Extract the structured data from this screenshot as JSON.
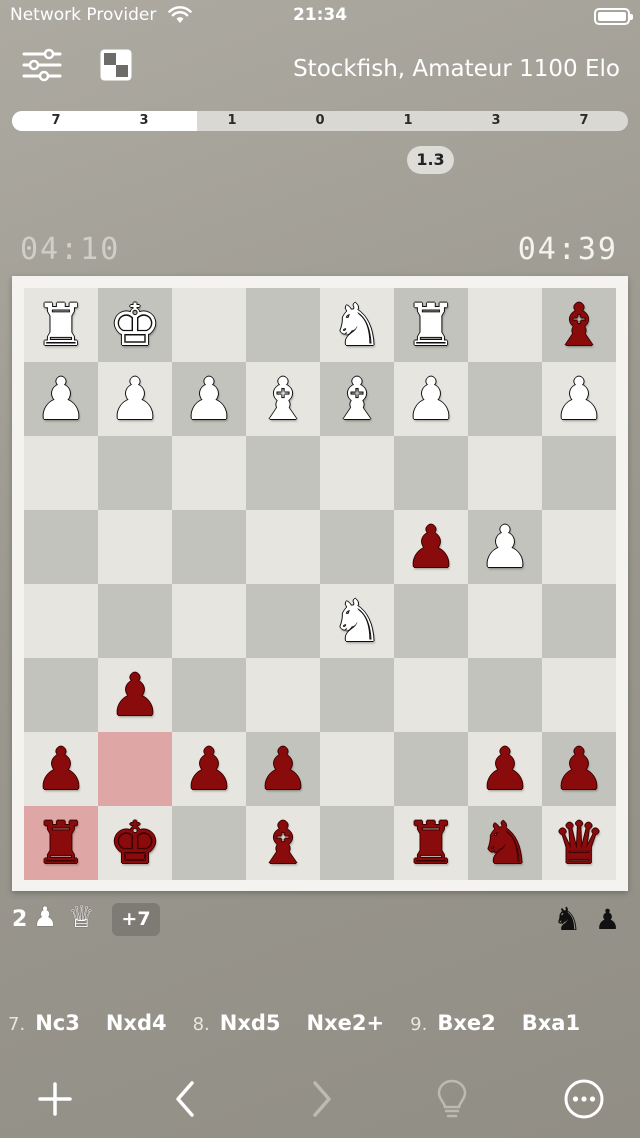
{
  "status_bar": {
    "carrier": "Network Provider",
    "time": "21:34"
  },
  "header": {
    "opponent": "Stockfish, Amateur 1100 Elo"
  },
  "eval_bar": {
    "ticks": [
      "7",
      "3",
      "1",
      "0",
      "1",
      "3",
      "7"
    ],
    "white_fraction": 0.3,
    "score": "1.3"
  },
  "clocks": {
    "left": "04:10",
    "right": "04:39"
  },
  "board": {
    "rows": [
      [
        "wR",
        "wK",
        "",
        "",
        "wN",
        "wR",
        "",
        "rB"
      ],
      [
        "wP",
        "wP",
        "wP",
        "wB",
        "wB",
        "wP",
        "",
        "wP"
      ],
      [
        "",
        "",
        "",
        "",
        "",
        "",
        "",
        ""
      ],
      [
        "",
        "",
        "",
        "",
        "",
        "rP",
        "wP",
        ""
      ],
      [
        "",
        "",
        "",
        "",
        "wN",
        "",
        "",
        ""
      ],
      [
        "",
        "rP",
        "",
        "",
        "",
        "",
        "",
        ""
      ],
      [
        "rP",
        "",
        "rP",
        "rP",
        "",
        "",
        "rP",
        "rP"
      ],
      [
        "rR",
        "rK",
        "",
        "rB",
        "",
        "rR",
        "rN",
        "rQ"
      ]
    ],
    "highlights": [
      "7-0",
      "6-1"
    ],
    "glyphs": {
      "K": "♚",
      "Q": "♛",
      "R": "♜",
      "B": "♝",
      "N": "♞",
      "P": "♟"
    },
    "colors": {
      "light": "#e6e5e0",
      "dark": "#c3c3bd",
      "highlight": "#dea7a5",
      "red_piece": "#8a0b0b"
    }
  },
  "captured": {
    "count": "2",
    "pawn_glyph": "♟",
    "queen_glyph": "♕",
    "advantage": "+7",
    "right_knight_glyph": "♞",
    "right_pawn_glyph": "♟"
  },
  "moves": [
    {
      "num": "7.",
      "white": "Nc3",
      "black": "Nxd4"
    },
    {
      "num": "8.",
      "white": "Nxd5",
      "black": "Nxe2+"
    },
    {
      "num": "9.",
      "white": "Bxe2",
      "black": "Bxa1"
    }
  ],
  "toolbar": {
    "icons": [
      "plus-icon",
      "chevron-left-icon",
      "chevron-right-icon",
      "lightbulb-icon",
      "ellipsis-circle-icon"
    ]
  }
}
